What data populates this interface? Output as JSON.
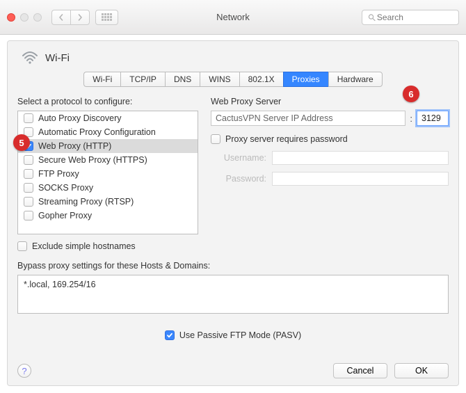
{
  "window": {
    "title": "Network",
    "search_placeholder": "Search"
  },
  "header": {
    "interface": "Wi-Fi"
  },
  "tabs": [
    "Wi-Fi",
    "TCP/IP",
    "DNS",
    "WINS",
    "802.1X",
    "Proxies",
    "Hardware"
  ],
  "active_tab_index": 5,
  "left": {
    "label": "Select a protocol to configure:",
    "protocols": [
      {
        "label": "Auto Proxy Discovery",
        "checked": false,
        "selected": false
      },
      {
        "label": "Automatic Proxy Configuration",
        "checked": false,
        "selected": false
      },
      {
        "label": "Web Proxy (HTTP)",
        "checked": true,
        "selected": true
      },
      {
        "label": "Secure Web Proxy (HTTPS)",
        "checked": false,
        "selected": false
      },
      {
        "label": "FTP Proxy",
        "checked": false,
        "selected": false
      },
      {
        "label": "SOCKS Proxy",
        "checked": false,
        "selected": false
      },
      {
        "label": "Streaming Proxy (RTSP)",
        "checked": false,
        "selected": false
      },
      {
        "label": "Gopher Proxy",
        "checked": false,
        "selected": false
      }
    ],
    "exclude_label": "Exclude simple hostnames",
    "exclude_checked": false
  },
  "right": {
    "title": "Web Proxy Server",
    "server_value": "CactusVPN Server IP Address",
    "port_value": "3129",
    "requires_password_label": "Proxy server requires password",
    "requires_password_checked": false,
    "username_label": "Username:",
    "password_label": "Password:",
    "username_value": "",
    "password_value": ""
  },
  "bypass": {
    "label": "Bypass proxy settings for these Hosts & Domains:",
    "value": "*.local, 169.254/16"
  },
  "passive": {
    "label": "Use Passive FTP Mode (PASV)",
    "checked": true
  },
  "footer": {
    "cancel": "Cancel",
    "ok": "OK"
  },
  "callouts": {
    "five": "5",
    "six": "6"
  }
}
